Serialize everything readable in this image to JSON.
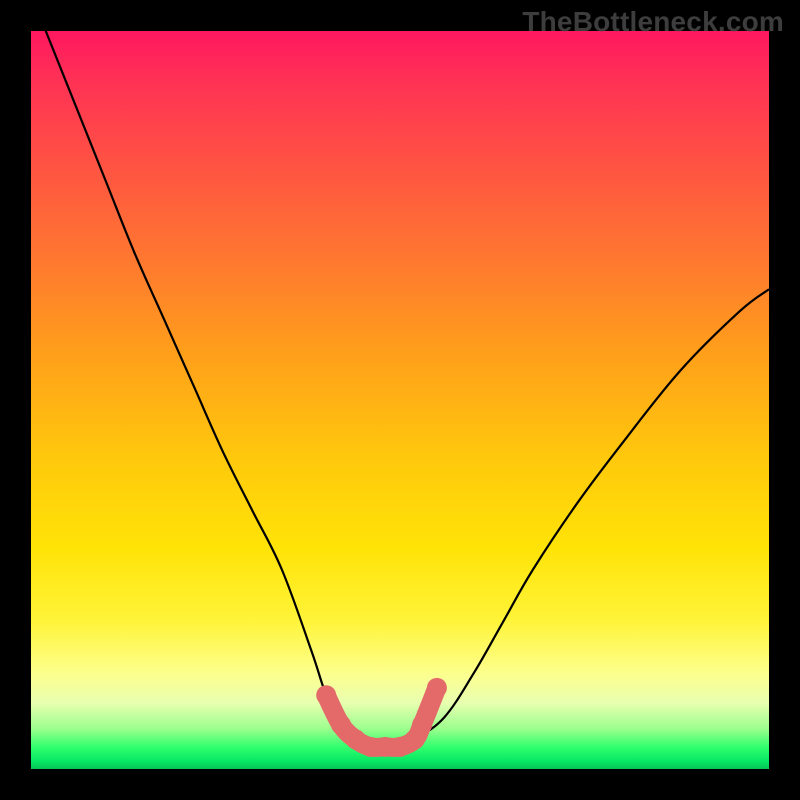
{
  "watermark": "TheBottleneck.com",
  "chart_data": {
    "type": "line",
    "title": "",
    "xlabel": "",
    "ylabel": "",
    "xlim": [
      0,
      100
    ],
    "ylim": [
      0,
      100
    ],
    "series": [
      {
        "name": "main-curve",
        "color": "#000000",
        "x": [
          2,
          6,
          10,
          14,
          18,
          22,
          26,
          30,
          34,
          38,
          40,
          42,
          44,
          46,
          48,
          50,
          52,
          56,
          60,
          64,
          68,
          74,
          80,
          88,
          96,
          100
        ],
        "y": [
          100,
          90,
          80,
          70,
          61,
          52,
          43,
          35,
          27,
          16,
          10,
          6,
          4,
          3,
          3,
          3,
          4,
          7,
          13,
          20,
          27,
          36,
          44,
          54,
          62,
          65
        ]
      },
      {
        "name": "optimal-band",
        "color": "#e46a6a",
        "x": [
          40,
          42,
          44,
          46,
          48,
          50,
          52,
          53,
          55
        ],
        "y": [
          10,
          6,
          4,
          3,
          3,
          3,
          4,
          6,
          11
        ]
      }
    ],
    "markers": {
      "name": "optimal-band-dots",
      "color": "#e46a6a",
      "x": [
        40,
        42,
        44,
        46,
        48,
        50,
        52,
        53,
        55
      ],
      "y": [
        10,
        6,
        4,
        3,
        3,
        3,
        4,
        6,
        11
      ]
    }
  },
  "colors": {
    "curve": "#000000",
    "band": "#e46a6a",
    "frame": "#000000"
  }
}
